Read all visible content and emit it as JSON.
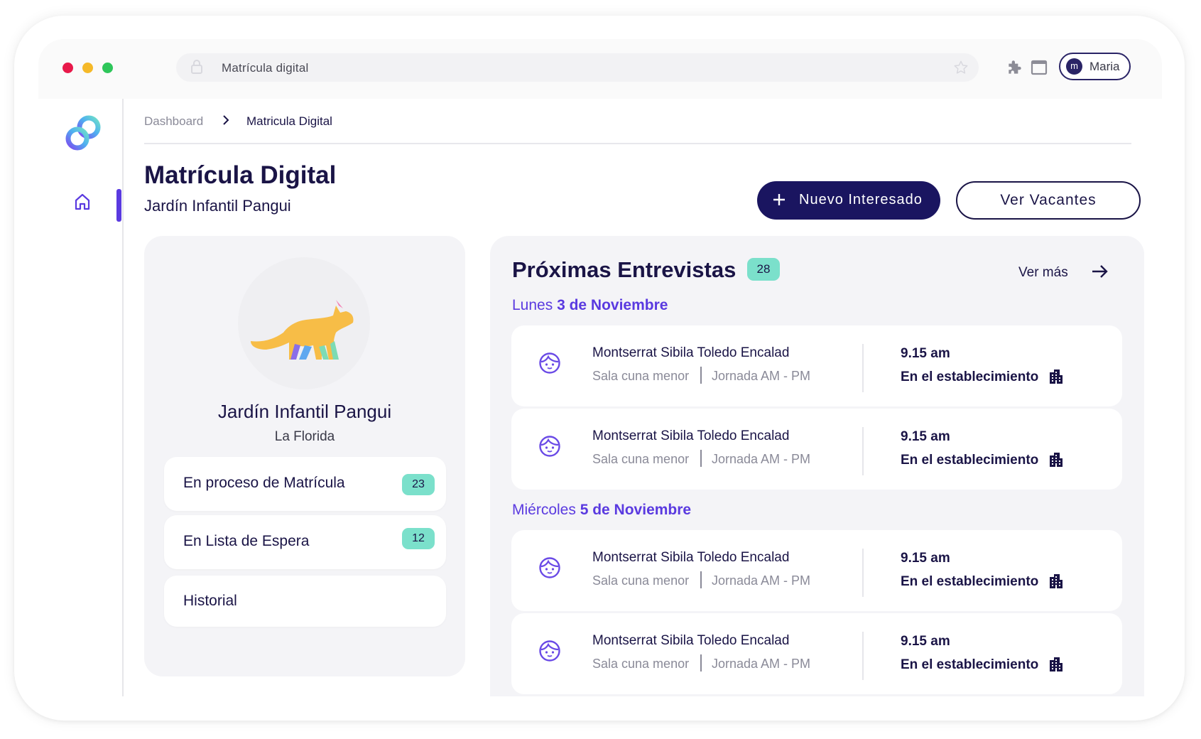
{
  "browser": {
    "url": "Matrícula digital",
    "profile_initial": "m",
    "profile_name": "Maria",
    "dots": [
      "#e8194a",
      "#f5b928",
      "#2ec65a"
    ]
  },
  "breadcrumb": {
    "items": [
      "Dashboard",
      "Matricula Digital"
    ]
  },
  "page": {
    "title": "Matrícula Digital",
    "subtitle": "Jardín Infantil Pangui"
  },
  "actions": {
    "new_label": "Nuevo Interesado",
    "vacancies_label": "Ver Vacantes"
  },
  "school": {
    "name": "Jardín Infantil Pangui",
    "location": "La Florida",
    "stats": [
      {
        "label": "En proceso de Matrícula",
        "count": "23"
      },
      {
        "label": "En Lista de Espera",
        "count": "12"
      },
      {
        "label": "Historial",
        "count": ""
      }
    ]
  },
  "interviews": {
    "title": "Próximas Entrevistas",
    "count": "28",
    "more_label": "Ver más",
    "days": [
      {
        "weekday": "Lunes",
        "date": "3 de Noviembre"
      },
      {
        "weekday": "Miércoles",
        "date": "5 de Noviembre"
      }
    ],
    "items": [
      {
        "name": "Montserrat Sibila Toledo Encalad",
        "level": "Sala cuna menor",
        "shift": "Jornada AM - PM",
        "time": "9.15 am",
        "location": "En el establecimiento"
      },
      {
        "name": "Montserrat Sibila Toledo Encalad",
        "level": "Sala cuna menor",
        "shift": "Jornada AM - PM",
        "time": "9.15 am",
        "location": "En el establecimiento"
      },
      {
        "name": "Montserrat Sibila Toledo Encalad",
        "level": "Sala cuna menor",
        "shift": "Jornada AM - PM",
        "time": "9.15 am",
        "location": "En el establecimiento"
      },
      {
        "name": "Montserrat Sibila Toledo Encalad",
        "level": "Sala cuna menor",
        "shift": "Jornada AM - PM",
        "time": "9.15 am",
        "location": "En el establecimiento"
      }
    ]
  },
  "colors": {
    "primary": "#1a1560",
    "accent": "#5a3ae0",
    "badge": "#7be0cb"
  }
}
